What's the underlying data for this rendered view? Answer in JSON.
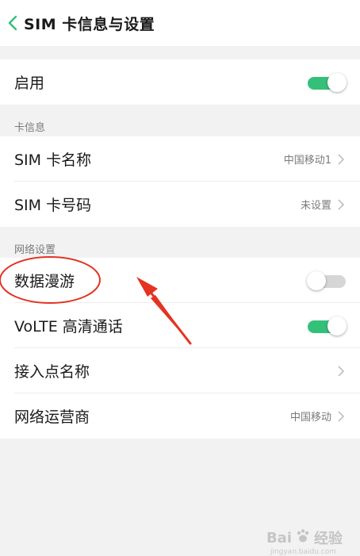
{
  "header": {
    "title": "SIM 卡信息与设置"
  },
  "enable": {
    "label": "启用",
    "on": true
  },
  "card_info": {
    "section_label": "卡信息",
    "name": {
      "label": "SIM 卡名称",
      "value": "中国移动1"
    },
    "number": {
      "label": "SIM 卡号码",
      "value": "未设置"
    }
  },
  "network": {
    "section_label": "网络设置",
    "roaming": {
      "label": "数据漫游",
      "on": false
    },
    "volte": {
      "label": "VoLTE 高清通话",
      "on": true
    },
    "apn": {
      "label": "接入点名称"
    },
    "operator": {
      "label": "网络运营商",
      "value": "中国移动"
    }
  },
  "colors": {
    "toggle_on": "#35c07a",
    "toggle_off": "#d6d6d6",
    "accent": "#35c07a",
    "annotation": "#e53322"
  },
  "watermark": {
    "brand": "Bai",
    "suffix": "经验",
    "url": "jingyan.baidu.com"
  }
}
